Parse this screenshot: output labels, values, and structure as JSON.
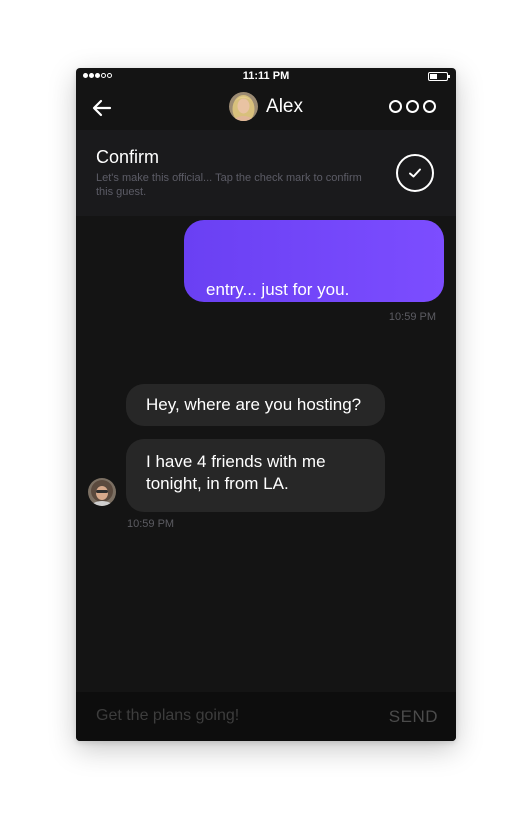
{
  "status_bar": {
    "time": "11:11 PM",
    "signal_bars": 3,
    "signal_total": 5,
    "battery_level": 0.45
  },
  "header": {
    "contact_name": "Alex",
    "back_icon": "arrow-left-icon",
    "more_icon": "more-dots-icon"
  },
  "confirm": {
    "title": "Confirm",
    "description": "Let's make this official... Tap the check mark to confirm this guest.",
    "icon": "checkmark-icon"
  },
  "messages": {
    "sent": {
      "text": "entry... just for you.",
      "time": "10:59 PM"
    },
    "received": [
      {
        "text": "Hey, where are you hosting?"
      },
      {
        "text": "I have 4 friends with me tonight, in from LA."
      }
    ],
    "received_time": "10:59 PM"
  },
  "composer": {
    "placeholder": "Get the plans going!",
    "value": "",
    "send_label": "SEND"
  },
  "colors": {
    "background": "#141414",
    "sent_bubble": "#7345f7",
    "received_bubble": "#272727",
    "muted_text": "#5c5c62"
  }
}
